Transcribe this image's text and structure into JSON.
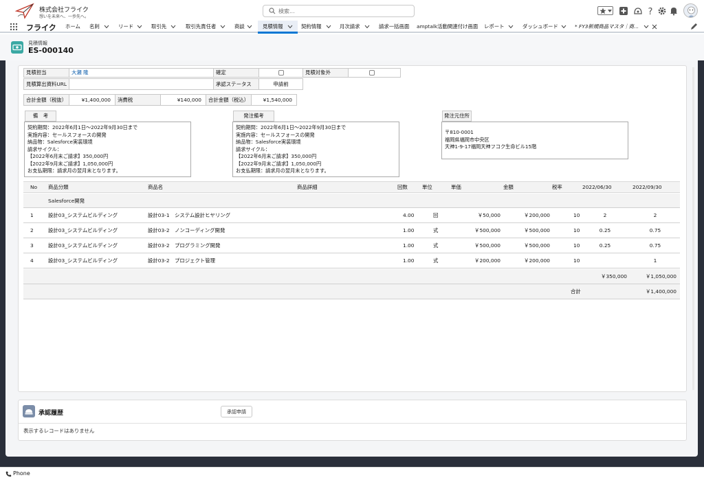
{
  "header": {
    "company_name": "株式会社フライク",
    "company_tagline": "想いを未来へ、一歩先へ。",
    "search_placeholder": "検索..."
  },
  "nav": {
    "app_name": "フライク",
    "tabs": [
      {
        "label": "ホーム"
      },
      {
        "label": "名刺"
      },
      {
        "label": "リード"
      },
      {
        "label": "取引先"
      },
      {
        "label": "取引先責任者"
      },
      {
        "label": "商談"
      },
      {
        "label": "見積情報"
      },
      {
        "label": "契約情報"
      },
      {
        "label": "月次請求"
      },
      {
        "label": "請求一括画面"
      },
      {
        "label": "amptalk活動関連付け画面"
      },
      {
        "label": "レポート"
      },
      {
        "label": "ダッシュボード"
      },
      {
        "label": "* FY3新規商品マスタ｜商..."
      }
    ]
  },
  "page_header": {
    "object_label": "見積情報",
    "record_name": "ES-000140"
  },
  "details": {
    "estimator_label": "見積担当",
    "estimator_value": "大瀬 隆",
    "confirmed_label": "確定",
    "excluded_label": "見積対象外",
    "url_label": "見積算出資料URL",
    "url_value": "",
    "approval_status_label": "承認ステータス",
    "approval_status_value": "申請前",
    "total_excl_label": "合計金額（税抜）",
    "total_excl_value": "¥1,400,000",
    "tax_label": "消費税",
    "tax_value": "¥140,000",
    "total_incl_label": "合計金額（税込）",
    "total_incl_value": "¥1,540,000"
  },
  "notes": {
    "remarks_label": "備　考",
    "remarks_lines": [
      "契約期間：2022年6月1日～2022年9月30日まで",
      "実施内容：セールスフォースの開発",
      "納品物：Salesforce実装環境",
      "請求サイクル：",
      "【2022年6月末ご請求】350,000円",
      "【2022年9月末ご請求】1,050,000円",
      "お支払期限：請求月の翌月末となります。"
    ],
    "order_remarks_label": "発注備考",
    "order_remarks_lines": [
      "契約期間：2022年6月1日～2022年9月30日まで",
      "実施内容：セールスフォースの開発",
      "納品物：Salesforce実装環境",
      "請求サイクル：",
      "【2022年6月末ご請求】350,000円",
      "【2022年9月末ご請求】1,050,000円",
      "お支払期限：請求月の翌月末となります。"
    ],
    "address_label": "発注元住所",
    "address_lines": [
      "〒810-0001",
      "福岡県福岡市中央区",
      "天神1-9-17福岡天神フコク生命ビル15階"
    ]
  },
  "table": {
    "columns": [
      "No",
      "商品分類",
      "商品名",
      "商品詳細",
      "回数",
      "単位",
      "単価",
      "金額",
      "税率",
      "2022/06/30",
      "2022/09/30"
    ],
    "group_label": "Salesforce開発",
    "rows": [
      {
        "no": "1",
        "category": "設計03_システムビルディング",
        "product": "設計03-1　システム設計ヒヤリング",
        "detail": "",
        "qty": "4.00",
        "unit": "回",
        "price": "￥50,000",
        "amount": "￥200,000",
        "tax": "10",
        "m1": "2",
        "m2": "2"
      },
      {
        "no": "2",
        "category": "設計03_システムビルディング",
        "product": "設計03-2　ノンコーディング開発",
        "detail": "",
        "qty": "1.00",
        "unit": "式",
        "price": "￥500,000",
        "amount": "￥500,000",
        "tax": "10",
        "m1": "0.25",
        "m2": "0.75"
      },
      {
        "no": "3",
        "category": "設計03_システムビルディング",
        "product": "設計03-2　プログラミング開発",
        "detail": "",
        "qty": "1.00",
        "unit": "式",
        "price": "￥500,000",
        "amount": "￥500,000",
        "tax": "10",
        "m1": "0.25",
        "m2": "0.75"
      },
      {
        "no": "4",
        "category": "設計03_システムビルディング",
        "product": "設計03-2　プロジェクト管理",
        "detail": "",
        "qty": "1.00",
        "unit": "式",
        "price": "￥200,000",
        "amount": "￥200,000",
        "tax": "10",
        "m1": "",
        "m2": "1"
      }
    ],
    "subtotal_m1": "￥350,000",
    "subtotal_m2": "￥1,050,000",
    "total_label": "合計",
    "total_value": "￥1,400,000"
  },
  "approval": {
    "title": "承認履歴",
    "button_label": "承認申請",
    "empty_message": "表示するレコードはありません"
  },
  "footer": {
    "phone_label": "Phone"
  },
  "colors": {
    "brand_blue": "#0176d3",
    "record_icon": "#3ba9a4",
    "frame_dark": "#2a2f3a"
  }
}
